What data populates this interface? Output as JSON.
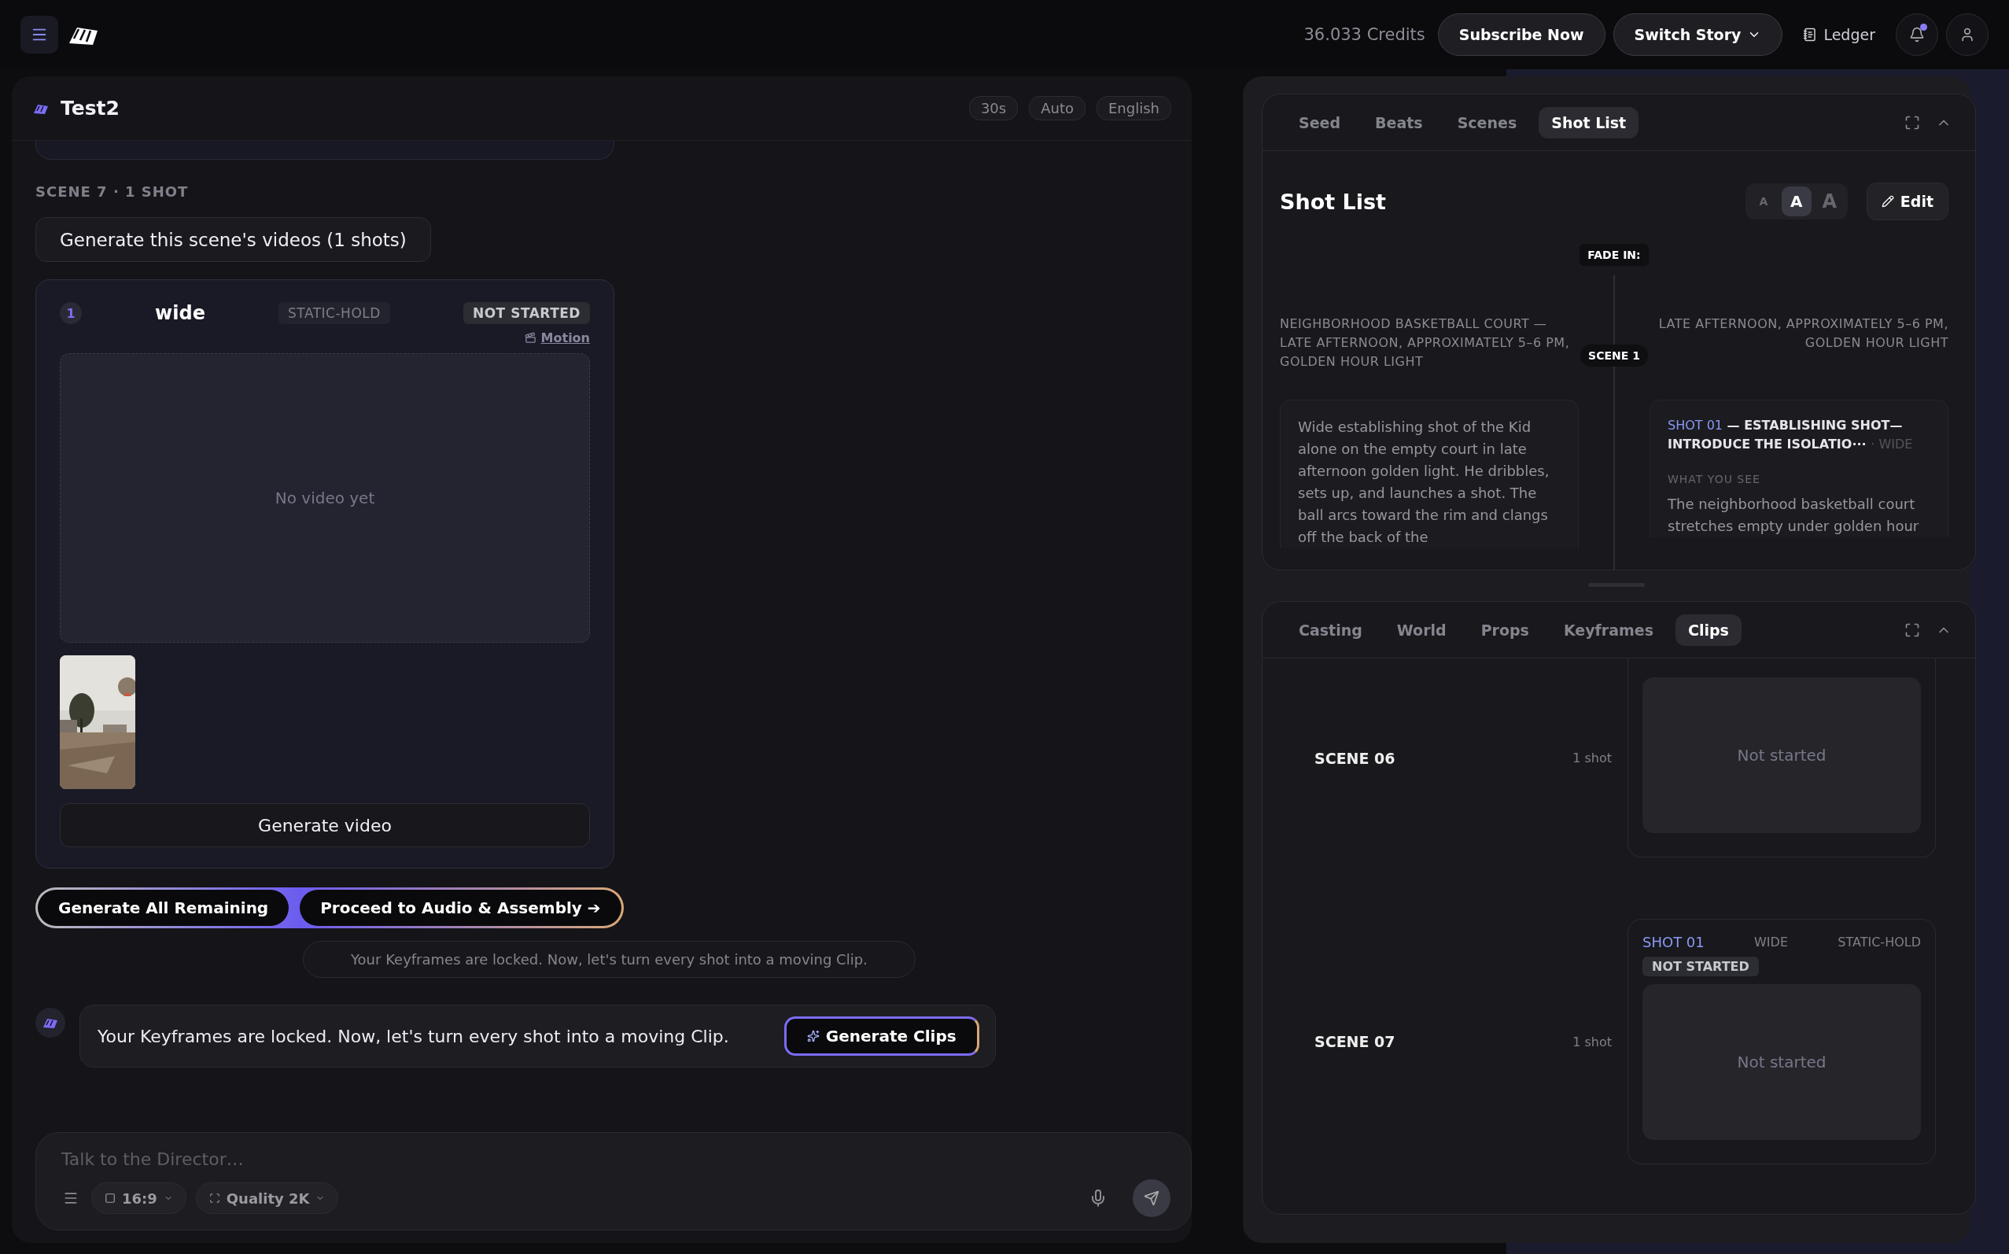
{
  "top_bar": {
    "credits": "36.033 Credits",
    "subscribe": "Subscribe Now",
    "switch_story": "Switch Story",
    "ledger": "Ledger",
    "notification_dot": true
  },
  "chat": {
    "title": "Test2",
    "chips": [
      "30s",
      "Auto",
      "English"
    ],
    "scene_heading": "SCENE 7 · 1 SHOT",
    "generate_scene_button": "Generate this scene's videos (1 shots)",
    "shot": {
      "number": "1",
      "framing": "wide",
      "movement": "STATIC-HOLD",
      "status": "NOT STARTED",
      "motion_link": "Motion",
      "empty_video": "No video yet",
      "generate_button": "Generate video"
    },
    "action_buttons": [
      "Generate All Remaining",
      "Proceed to Audio & Assembly ➔"
    ],
    "system_note": "Your Keyframes are locked. Now, let's turn every shot into a moving Clip.",
    "message": {
      "text": "Your Keyframes are locked. Now, let's turn every shot into a moving Clip.",
      "button": "Generate Clips"
    },
    "composer": {
      "placeholder": "Talk to the Director…",
      "aspect": "16:9",
      "quality": "Quality 2K"
    }
  },
  "story_panel": {
    "tabs": [
      {
        "label": "Seed",
        "selected": false
      },
      {
        "label": "Beats",
        "selected": false
      },
      {
        "label": "Scenes",
        "selected": false
      },
      {
        "label": "Shot List",
        "selected": true
      }
    ],
    "heading": "Shot List",
    "text_sizes": [
      {
        "label": "A",
        "selected": false
      },
      {
        "label": "A",
        "selected": true
      },
      {
        "label": "A",
        "selected": false
      }
    ],
    "edit": "Edit",
    "fade_in": "FADE IN:",
    "scene_marker": "SCENE 1",
    "location": "NEIGHBORHOOD BASKETBALL COURT — LATE AFTERNOON, APPROXIMATELY 5–6 PM, GOLDEN HOUR LIGHT",
    "time_of_day": "LATE AFTERNOON, APPROXIMATELY 5–6 PM, GOLDEN HOUR LIGHT",
    "action": "Wide establishing shot of the Kid alone on the empty court in late afternoon golden light. He dribbles, sets up, and launches a shot. The ball arcs toward the rim and clangs off the back of the",
    "shot_card": {
      "number": "SHOT 01",
      "title": "— ESTABLISHING SHOT— INTRODUCE THE ISOLATIO···",
      "separator": "·",
      "framing": "WIDE",
      "section_label": "WHAT YOU SEE",
      "description": "The neighborhood basketball court stretches empty under golden hour"
    }
  },
  "production_panel": {
    "tabs": [
      {
        "label": "Casting",
        "selected": false
      },
      {
        "label": "World",
        "selected": false
      },
      {
        "label": "Props",
        "selected": false
      },
      {
        "label": "Keyframes",
        "selected": false
      },
      {
        "label": "Clips",
        "selected": true
      }
    ],
    "scenes": [
      {
        "label": "SCENE 06",
        "count": "1 shot",
        "clip": {
          "status_text": "Not started"
        }
      },
      {
        "label": "SCENE 07",
        "count": "1 shot",
        "clip": {
          "shot": "SHOT 01",
          "framing": "WIDE",
          "movement": "STATIC-HOLD",
          "status": "NOT STARTED",
          "status_text": "Not started"
        }
      }
    ]
  }
}
